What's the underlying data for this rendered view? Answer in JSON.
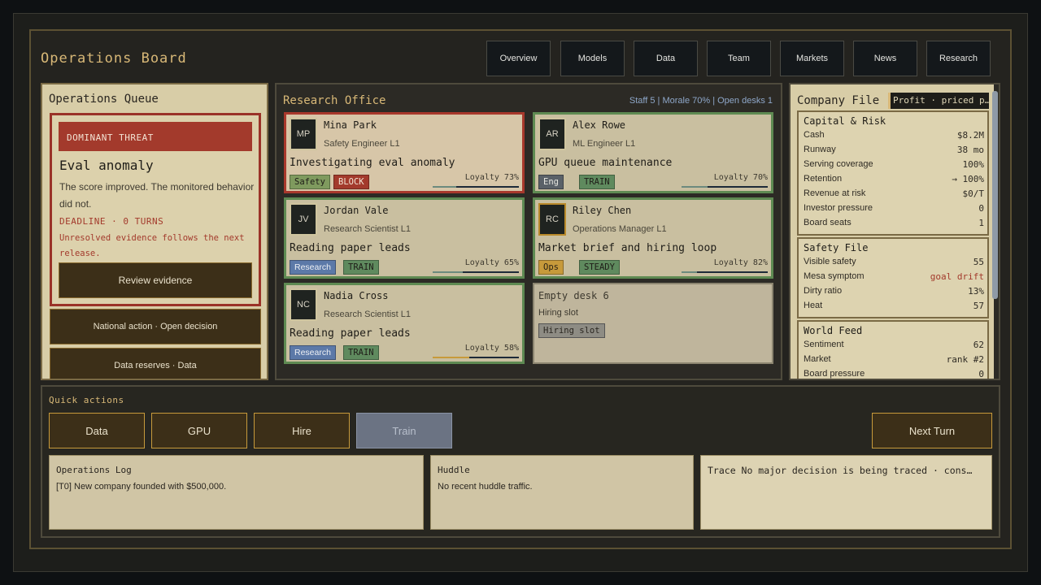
{
  "header": {
    "title": "Operations Board",
    "nav": [
      "Overview",
      "Models",
      "Data",
      "Team",
      "Markets",
      "News",
      "Research"
    ]
  },
  "queue": {
    "title": "Operations Queue",
    "threat": {
      "tag": "DOMINANT THREAT",
      "title": "Eval anomaly",
      "desc": "The score improved. The monitored behavior did not.",
      "deadline": "DEADLINE · 0 TURNS",
      "warning": "Unresolved evidence follows the next release.",
      "button": "Review evidence"
    },
    "items": [
      "National action · Open decision",
      "Data reserves · Data"
    ]
  },
  "office": {
    "title": "Research Office",
    "stats": "Staff 5 | Morale 70% | Open desks 1",
    "staff": [
      {
        "initials": "MP",
        "name": "Mina Park",
        "role": "Safety Engineer L1",
        "task": "Investigating eval anomaly",
        "tag1": "Safety",
        "tag2": "BLOCK",
        "loyalty_label": "Loyalty 73%",
        "loyalty": 0.73
      },
      {
        "initials": "AR",
        "name": "Alex Rowe",
        "role": "ML Engineer L1",
        "task": "GPU queue maintenance",
        "tag1": "Eng",
        "tag2": "TRAIN",
        "loyalty_label": "Loyalty 70%",
        "loyalty": 0.7
      },
      {
        "initials": "JV",
        "name": "Jordan Vale",
        "role": "Research Scientist L1",
        "task": "Reading paper leads",
        "tag1": "Research",
        "tag2": "TRAIN",
        "loyalty_label": "Loyalty 65%",
        "loyalty": 0.65
      },
      {
        "initials": "RC",
        "name": "Riley Chen",
        "role": "Operations Manager L1",
        "task": "Market brief and hiring loop",
        "tag1": "Ops",
        "tag2": "STEADY",
        "loyalty_label": "Loyalty 82%",
        "loyalty": 0.82
      },
      {
        "initials": "NC",
        "name": "Nadia Cross",
        "role": "Research Scientist L1",
        "task": "Reading paper leads",
        "tag1": "Research",
        "tag2": "TRAIN",
        "loyalty_label": "Loyalty 58%",
        "loyalty": 0.58
      }
    ],
    "empty": {
      "title": "Empty desk 6",
      "subtitle": "Hiring slot",
      "tag": "Hiring slot"
    }
  },
  "company": {
    "title": "Company File",
    "profit_tag": "Profit · priced p…",
    "capital": {
      "title": "Capital & Risk",
      "rows": [
        [
          "Cash",
          "$8.2M"
        ],
        [
          "Runway",
          "38 mo"
        ],
        [
          "Serving coverage",
          "100%"
        ],
        [
          "Retention",
          "→ 100%"
        ],
        [
          "Revenue at risk",
          "$0/T"
        ],
        [
          "Investor pressure",
          "0"
        ],
        [
          "Board seats",
          "1"
        ]
      ]
    },
    "safety": {
      "title": "Safety File",
      "rows": [
        [
          "Visible safety",
          "55"
        ],
        [
          "Mesa symptom",
          "goal drift"
        ],
        [
          "Dirty ratio",
          "13%"
        ],
        [
          "Heat",
          "57"
        ]
      ]
    },
    "world": {
      "title": "World Feed",
      "rows": [
        [
          "Sentiment",
          "62"
        ],
        [
          "Market",
          "rank #2"
        ],
        [
          "Board pressure",
          "0"
        ]
      ]
    }
  },
  "actions": {
    "title": "Quick actions",
    "buttons": [
      "Data",
      "GPU",
      "Hire",
      "Train"
    ],
    "next": "Next Turn"
  },
  "logs": {
    "ops_title": "Operations Log",
    "ops_text": "[T0] New company founded with $500,000.",
    "huddle_title": "Huddle",
    "huddle_text": "No recent huddle traffic.",
    "trace_text": "Trace No major decision is being traced · cons…"
  },
  "colors": {
    "accent": "#d8b877",
    "danger": "#a33a2c",
    "safe": "#5e8a52",
    "panel": "#d8cda7"
  }
}
